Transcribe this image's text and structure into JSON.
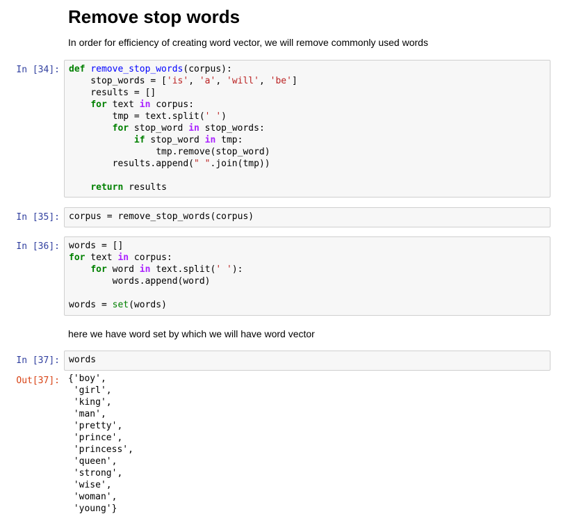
{
  "markdown": {
    "heading": "Remove stop words",
    "intro": "In order for efficiency of creating word vector, we will remove commonly used words",
    "word_set_note": "here we have word set by which we will have word vector"
  },
  "cells": [
    {
      "prompt": "In [34]:",
      "lines": [
        [
          [
            "kw",
            "def"
          ],
          [
            "t",
            " "
          ],
          [
            "fn",
            "remove_stop_words"
          ],
          [
            "t",
            "(corpus):"
          ]
        ],
        [
          [
            "t",
            "    stop_words = ["
          ],
          [
            "str",
            "'is'"
          ],
          [
            "t",
            ", "
          ],
          [
            "str",
            "'a'"
          ],
          [
            "t",
            ", "
          ],
          [
            "str",
            "'will'"
          ],
          [
            "t",
            ", "
          ],
          [
            "str",
            "'be'"
          ],
          [
            "t",
            "]"
          ]
        ],
        [
          [
            "t",
            "    results = []"
          ]
        ],
        [
          [
            "t",
            "    "
          ],
          [
            "kw",
            "for"
          ],
          [
            "t",
            " text "
          ],
          [
            "op",
            "in"
          ],
          [
            "t",
            " corpus:"
          ]
        ],
        [
          [
            "t",
            "        tmp = text.split("
          ],
          [
            "str",
            "' '"
          ],
          [
            "t",
            ")"
          ]
        ],
        [
          [
            "t",
            "        "
          ],
          [
            "kw",
            "for"
          ],
          [
            "t",
            " stop_word "
          ],
          [
            "op",
            "in"
          ],
          [
            "t",
            " stop_words:"
          ]
        ],
        [
          [
            "t",
            "            "
          ],
          [
            "kw",
            "if"
          ],
          [
            "t",
            " stop_word "
          ],
          [
            "op",
            "in"
          ],
          [
            "t",
            " tmp:"
          ]
        ],
        [
          [
            "t",
            "                tmp.remove(stop_word)"
          ]
        ],
        [
          [
            "t",
            "        results.append("
          ],
          [
            "str",
            "\" \""
          ],
          [
            "t",
            ".join(tmp))"
          ]
        ],
        [
          [
            "t",
            ""
          ]
        ],
        [
          [
            "t",
            "    "
          ],
          [
            "kw",
            "return"
          ],
          [
            "t",
            " results"
          ]
        ]
      ]
    },
    {
      "prompt": "In [35]:",
      "lines": [
        [
          [
            "t",
            "corpus = remove_stop_words(corpus)"
          ]
        ]
      ]
    },
    {
      "prompt": "In [36]:",
      "lines": [
        [
          [
            "t",
            "words = []"
          ]
        ],
        [
          [
            "kw",
            "for"
          ],
          [
            "t",
            " text "
          ],
          [
            "op",
            "in"
          ],
          [
            "t",
            " corpus:"
          ]
        ],
        [
          [
            "t",
            "    "
          ],
          [
            "kw",
            "for"
          ],
          [
            "t",
            " word "
          ],
          [
            "op",
            "in"
          ],
          [
            "t",
            " text.split("
          ],
          [
            "str",
            "' '"
          ],
          [
            "t",
            "):"
          ]
        ],
        [
          [
            "t",
            "        words.append(word)"
          ]
        ],
        [
          [
            "t",
            ""
          ]
        ],
        [
          [
            "t",
            "words = "
          ],
          [
            "bi",
            "set"
          ],
          [
            "t",
            "(words)"
          ]
        ]
      ]
    },
    {
      "prompt": "In [37]:",
      "lines": [
        [
          [
            "t",
            "words"
          ]
        ]
      ]
    }
  ],
  "output": {
    "prompt": "Out[37]:",
    "lines": [
      "{'boy',",
      " 'girl',",
      " 'king',",
      " 'man',",
      " 'pretty',",
      " 'prince',",
      " 'princess',",
      " 'queen',",
      " 'strong',",
      " 'wise',",
      " 'woman',",
      " 'young'}"
    ]
  }
}
